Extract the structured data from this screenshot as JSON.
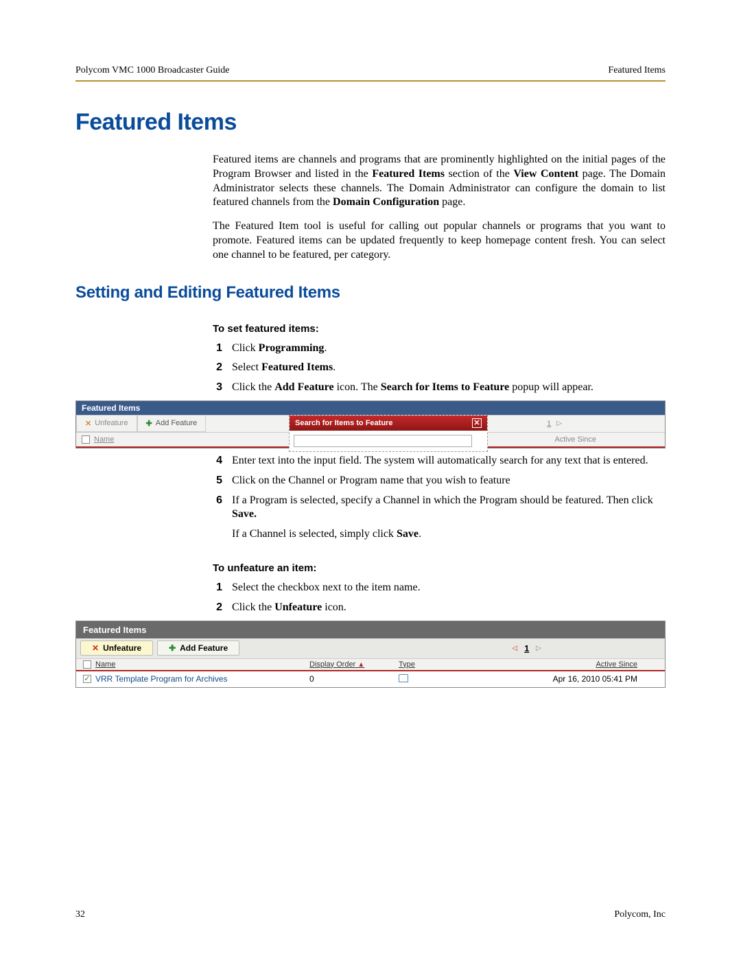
{
  "header": {
    "left": "Polycom VMC 1000 Broadcaster Guide",
    "right": "Featured Items"
  },
  "h1": "Featured Items",
  "para1_pre": "Featured items are channels and programs that are prominently highlighted on the initial pages of the Program Browser and listed in the ",
  "para1_b1": "Featured Items",
  "para1_mid1": " section of the ",
  "para1_b2": "View Content",
  "para1_mid2": " page. The Domain Administrator selects these channels. The Domain Administrator can configure the domain to list featured channels from the ",
  "para1_b3": "Domain Configuration",
  "para1_post": " page.",
  "para2": "The Featured Item tool is useful for calling out popular channels or programs that you want to promote. Featured items can be updated frequently to keep homepage content fresh. You can select one channel to be featured, per category.",
  "h2": "Setting and Editing Featured Items",
  "sub1": "To set featured items:",
  "s1": {
    "pre": "Click ",
    "b": "Programming",
    "post": "."
  },
  "s2": {
    "pre": "Select ",
    "b": "Featured Items",
    "post": "."
  },
  "s3": {
    "pre": "Click the ",
    "b1": "Add Feature",
    "mid": " icon. The ",
    "b2": "Search for Items to Feature",
    "post": " popup will appear."
  },
  "s4": "Enter text into the input field. The system will automatically search for any text that is entered.",
  "s5": "Click on the Channel or Program name that you wish to feature",
  "s6": {
    "pre": "If a Program is selected, specify a Channel in which the Program should be featured. Then click ",
    "b": "Save.",
    "p2_pre": "If a Channel is selected, simply click ",
    "p2_b": "Save",
    "p2_post": "."
  },
  "sub2": "To unfeature an item:",
  "u1": "Select the checkbox next to the item name.",
  "u2": {
    "pre": "Click the ",
    "b": "Unfeature",
    "post": " icon."
  },
  "shot1": {
    "title": "Featured Items",
    "unfeature": "Unfeature",
    "add": "Add Feature",
    "page": "1",
    "name": "Name",
    "active": "Active Since",
    "popup_title": "Search for Items to Feature",
    "popup_close": "✕"
  },
  "shot2": {
    "title": "Featured Items",
    "unfeature": "Unfeature",
    "add": "Add Feature",
    "page": "1",
    "h_name": "Name",
    "h_order": "Display Order",
    "h_type": "Type",
    "h_active": "Active Since",
    "row_name": "VRR Template Program for Archives",
    "row_order": "0",
    "row_active": "Apr 16, 2010 05:41 PM"
  },
  "footer": {
    "page": "32",
    "company": "Polycom, Inc"
  }
}
